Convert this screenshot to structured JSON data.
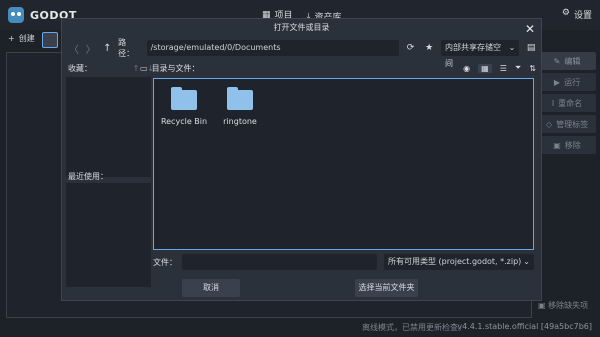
{
  "app": {
    "logo_text": "GODOT"
  },
  "tabs": [
    {
      "label": "项目",
      "icon": "list-icon"
    },
    {
      "label": "资产库",
      "icon": "download-icon"
    }
  ],
  "settings_label": "设置",
  "pm": {
    "create_label": "创建"
  },
  "side_buttons": [
    {
      "label": "编辑",
      "icon": "pencil-icon"
    },
    {
      "label": "运行",
      "icon": "play-icon"
    },
    {
      "label": "重命名",
      "icon": "rename-icon"
    },
    {
      "label": "管理标签",
      "icon": "tag-icon"
    },
    {
      "label": "移除",
      "icon": "trash-icon"
    }
  ],
  "remove_missing": "移除缺失项",
  "status": {
    "left": "离线模式，已禁用更新检查。",
    "right": "v4.4.1.stable.official [49a5bc7b6]"
  },
  "dialog": {
    "title": "打开文件或目录",
    "path_label": "路径：",
    "path_value": "/storage/emulated/0/Documents",
    "drive": "内部共享存储空间",
    "favorites_label": "收藏：",
    "recent_label": "最近使用：",
    "files_label": "目录与文件：",
    "files": [
      {
        "name": "Recycle Bin"
      },
      {
        "name": "ringtone"
      }
    ],
    "filename_label": "文件：",
    "filename_value": "",
    "filter": "所有可用类型 (project.godot, *.zip)",
    "cancel_label": "取消",
    "select_label": "选择当前文件夹"
  }
}
